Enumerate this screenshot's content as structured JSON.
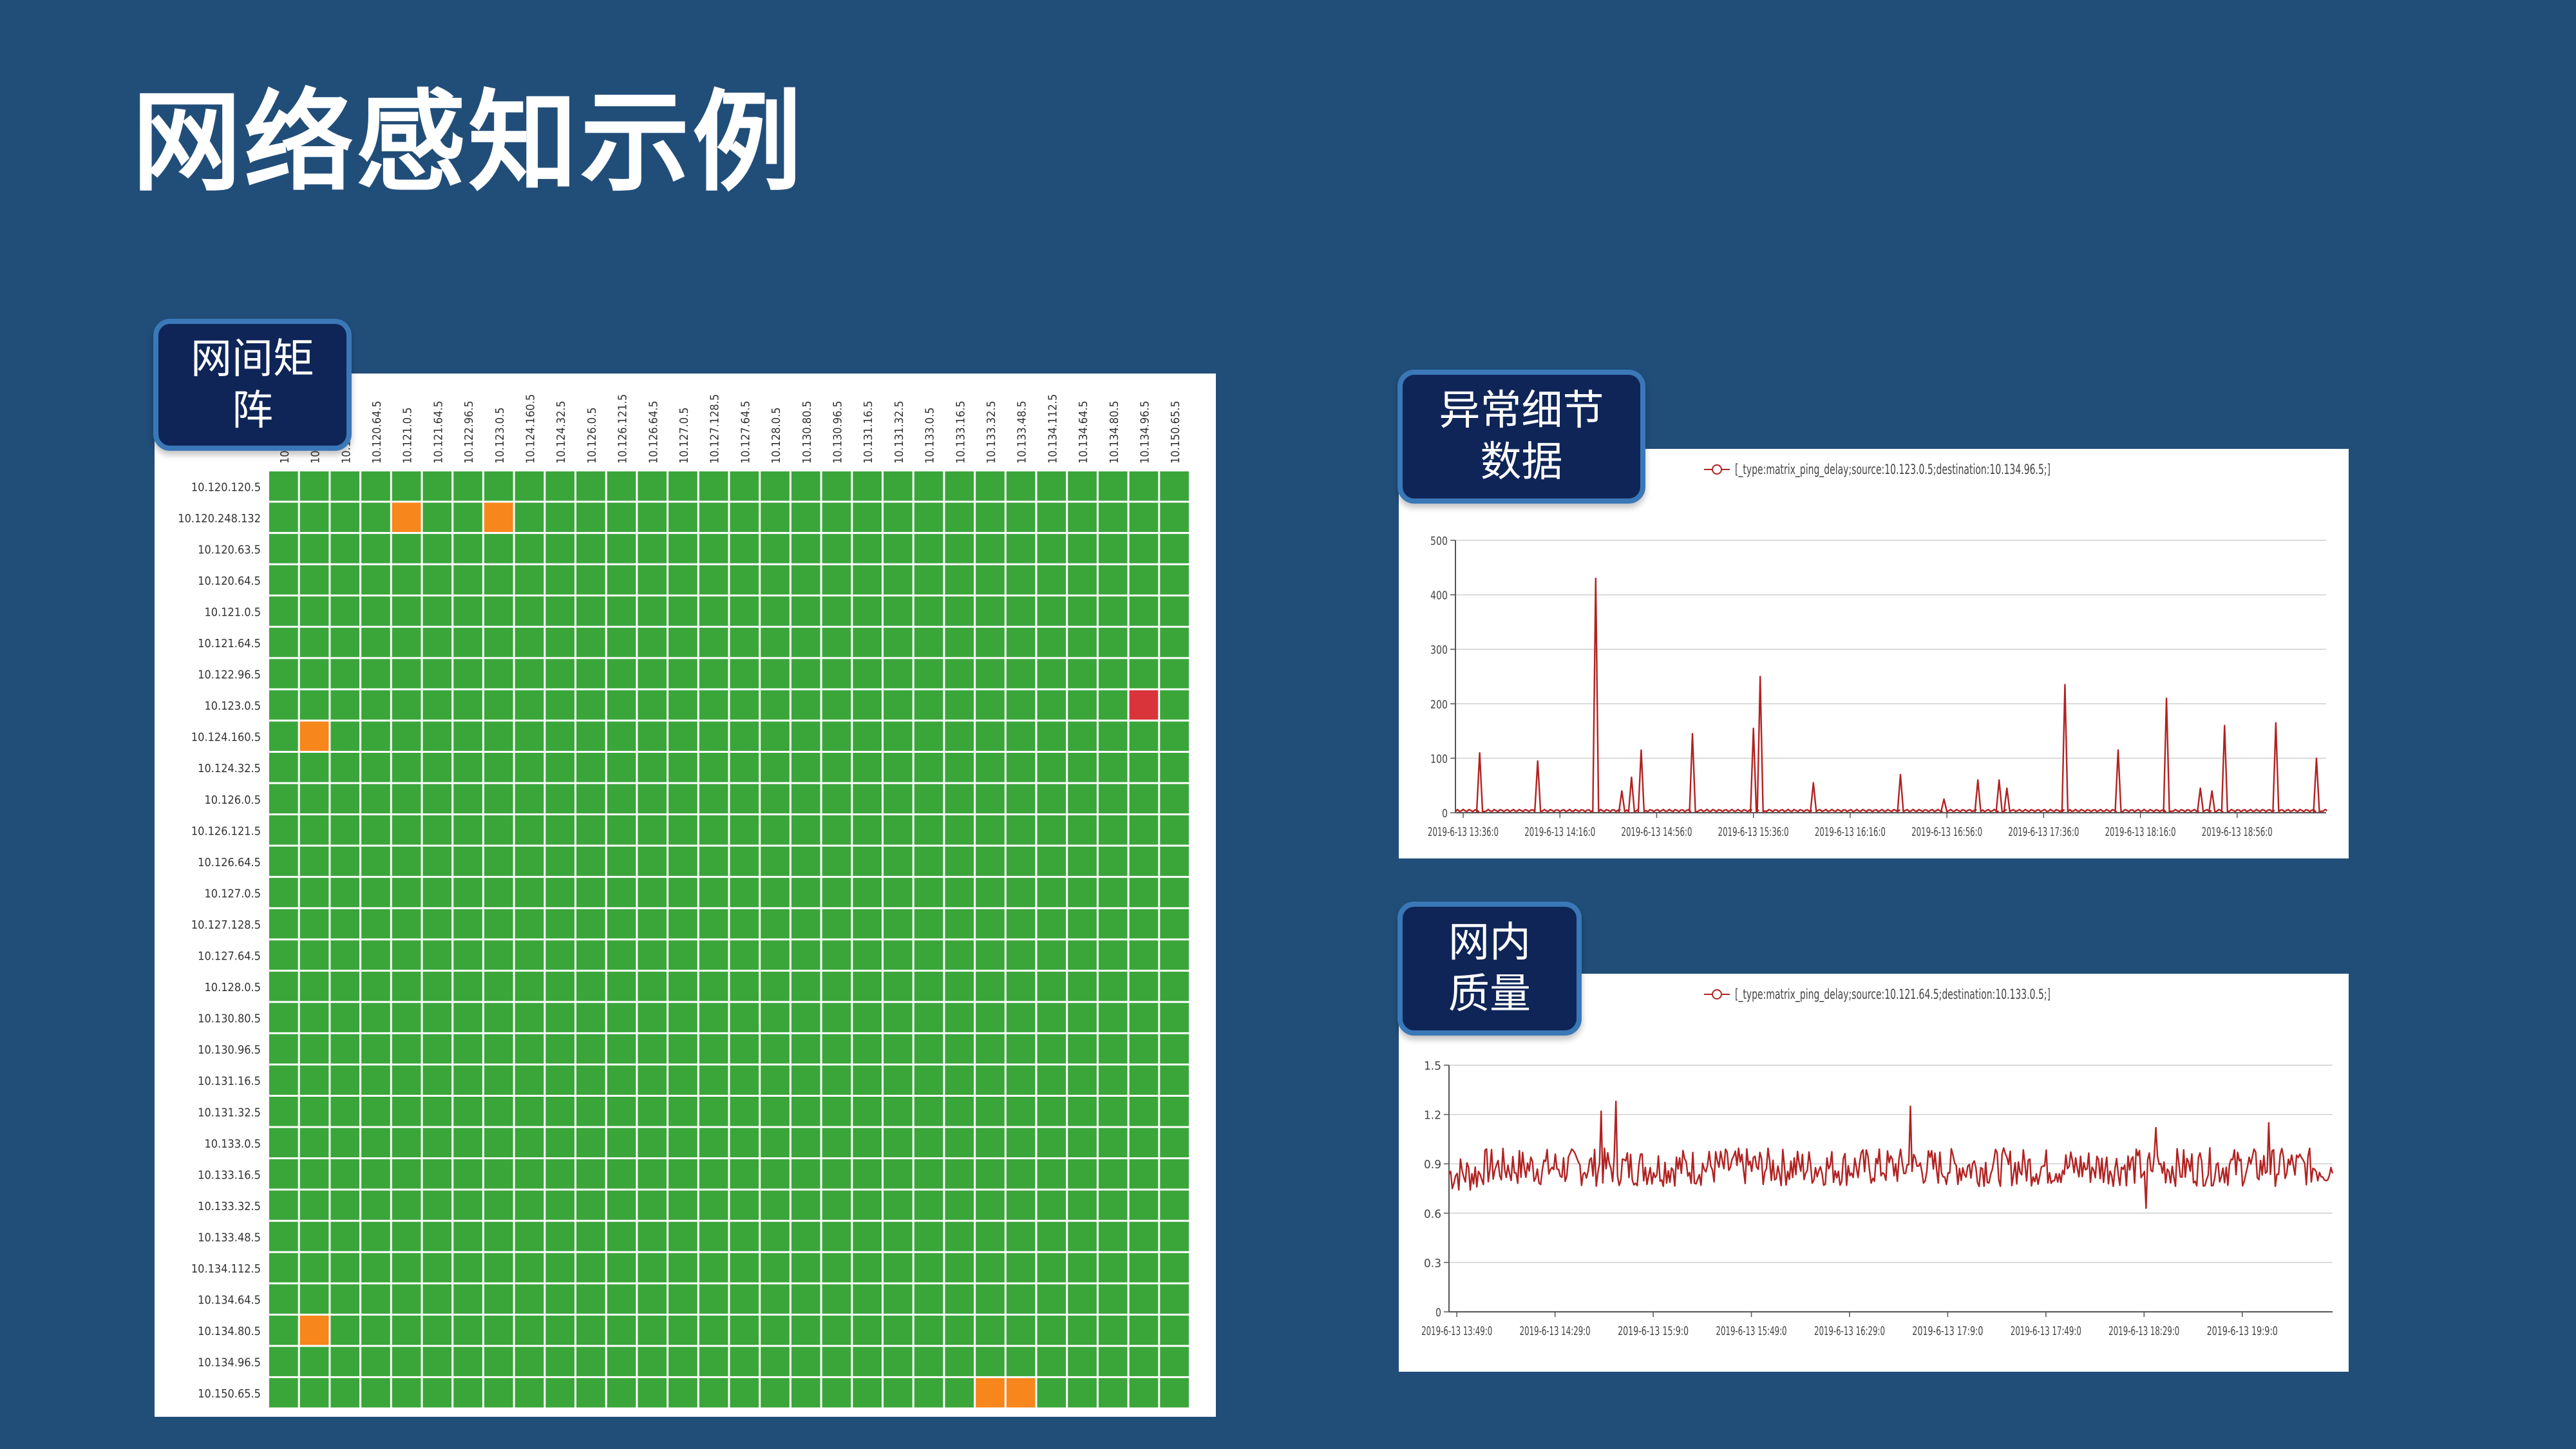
{
  "page": {
    "title": "网络感知示例"
  },
  "badges": {
    "matrix": "网间矩阵",
    "anomaly": "异常细节数据",
    "quality": "网内质量"
  },
  "colors": {
    "background": "#214e79",
    "ok": "#3aa63a",
    "warn": "#f7861c",
    "alert": "#d9343a",
    "line": "#b22222",
    "badge": "#0f2557"
  },
  "chart_data": [
    {
      "type": "heatmap",
      "title": "",
      "x_labels": [
        "10.120.120.5",
        "10.120.248.132",
        "10.120.63.5",
        "10.120.64.5",
        "10.121.0.5",
        "10.121.64.5",
        "10.122.96.5",
        "10.123.0.5",
        "10.124.160.5",
        "10.124.32.5",
        "10.126.0.5",
        "10.126.121.5",
        "10.126.64.5",
        "10.127.0.5",
        "10.127.128.5",
        "10.127.64.5",
        "10.128.0.5",
        "10.130.80.5",
        "10.130.96.5",
        "10.131.16.5",
        "10.131.32.5",
        "10.133.0.5",
        "10.133.16.5",
        "10.133.32.5",
        "10.133.48.5",
        "10.134.112.5",
        "10.134.64.5",
        "10.134.80.5",
        "10.134.96.5",
        "10.150.65.5"
      ],
      "y_labels": [
        "10.120.120.5",
        "10.120.248.132",
        "10.120.63.5",
        "10.120.64.5",
        "10.121.0.5",
        "10.121.64.5",
        "10.122.96.5",
        "10.123.0.5",
        "10.124.160.5",
        "10.124.32.5",
        "10.126.0.5",
        "10.126.121.5",
        "10.126.64.5",
        "10.127.0.5",
        "10.127.128.5",
        "10.127.64.5",
        "10.128.0.5",
        "10.130.80.5",
        "10.130.96.5",
        "10.131.16.5",
        "10.131.32.5",
        "10.133.0.5",
        "10.133.16.5",
        "10.133.32.5",
        "10.133.48.5",
        "10.134.112.5",
        "10.134.64.5",
        "10.134.80.5",
        "10.134.96.5",
        "10.150.65.5"
      ],
      "default_status": "ok",
      "cells": [
        {
          "row": 1,
          "col": 4,
          "status": "warn"
        },
        {
          "row": 1,
          "col": 7,
          "status": "warn"
        },
        {
          "row": 7,
          "col": 28,
          "status": "alert"
        },
        {
          "row": 8,
          "col": 1,
          "status": "warn"
        },
        {
          "row": 27,
          "col": 1,
          "status": "warn"
        },
        {
          "row": 29,
          "col": 23,
          "status": "warn"
        },
        {
          "row": 29,
          "col": 24,
          "status": "warn"
        }
      ]
    },
    {
      "type": "line",
      "legend": "[_type:matrix_ping_delay;source:10.123.0.5;destination:10.134.96.5;]",
      "legend_placement": "top-center",
      "ylim": [
        0,
        500
      ],
      "y_ticks": [
        "0",
        "100",
        "200",
        "300",
        "400",
        "500"
      ],
      "x_ticks": [
        "2019-6-13 13:36:0",
        "2019-6-13 14:16:0",
        "2019-6-13 14:56:0",
        "2019-6-13 15:36:0",
        "2019-6-13 16:16:0",
        "2019-6-13 16:56:0",
        "2019-6-13 17:36:0",
        "2019-6-13 18:16:0",
        "2019-6-13 18:56:0"
      ],
      "x_range": [
        0,
        9
      ],
      "spikes": [
        [
          0.25,
          110
        ],
        [
          0.85,
          95
        ],
        [
          1.45,
          430
        ],
        [
          1.72,
          40
        ],
        [
          1.82,
          65
        ],
        [
          1.92,
          115
        ],
        [
          2.45,
          145
        ],
        [
          3.08,
          155
        ],
        [
          3.15,
          250
        ],
        [
          3.7,
          55
        ],
        [
          4.6,
          70
        ],
        [
          5.05,
          25
        ],
        [
          5.4,
          60
        ],
        [
          5.62,
          60
        ],
        [
          5.7,
          45
        ],
        [
          6.3,
          235
        ],
        [
          6.85,
          115
        ],
        [
          7.35,
          210
        ],
        [
          7.7,
          45
        ],
        [
          7.82,
          40
        ],
        [
          7.95,
          160
        ],
        [
          8.48,
          165
        ],
        [
          8.9,
          100
        ]
      ],
      "baseline": 2,
      "grid": true
    },
    {
      "type": "line",
      "legend": "[_type:matrix_ping_delay;source:10.121.64.5;destination:10.133.0.5;]",
      "legend_placement": "top-center",
      "ylim": [
        0,
        1.5
      ],
      "y_ticks": [
        "0",
        "0.3",
        "0.6",
        "0.9",
        "1.2",
        "1.5"
      ],
      "x_ticks": [
        "2019-6-13 13:49:0",
        "2019-6-13 14:29:0",
        "2019-6-13 15:9:0",
        "2019-6-13 15:49:0",
        "2019-6-13 16:29:0",
        "2019-6-13 17:9:0",
        "2019-6-13 17:49:0",
        "2019-6-13 18:29:0",
        "2019-6-13 19:9:0"
      ],
      "x_range": [
        0,
        9
      ],
      "mean": 0.88,
      "noise": 0.09,
      "peaks": [
        [
          1.55,
          1.22
        ],
        [
          1.7,
          1.28
        ],
        [
          4.7,
          1.25
        ],
        [
          7.2,
          1.12
        ],
        [
          8.35,
          1.15
        ]
      ],
      "dips": [
        [
          7.1,
          0.63
        ]
      ],
      "grid": true
    }
  ]
}
